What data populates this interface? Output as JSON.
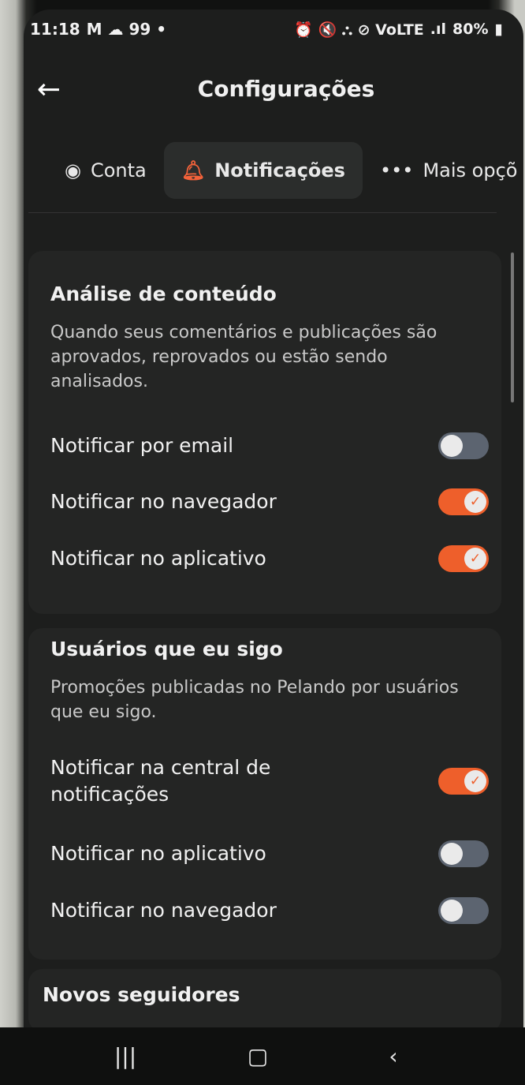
{
  "status_bar": {
    "time": "11:18",
    "left_icons": "M ☁ 99 •",
    "right_icons": "⏰ 🔇 ⛬ ⊘ VoLTE",
    "battery": "80%"
  },
  "header": {
    "title": "Configurações"
  },
  "tabs": [
    {
      "label": "Conta",
      "icon": "user-circle-icon"
    },
    {
      "label": "Notificações",
      "icon": "bell-icon"
    },
    {
      "label": "Mais opçõ",
      "icon": "more-dots-icon"
    }
  ],
  "sections": [
    {
      "title": "Análise de conteúdo",
      "description": "Quando seus comentários e publicações são aprovados, reprovados ou estão sendo analisados.",
      "rows": [
        {
          "label": "Notificar por email",
          "on": false
        },
        {
          "label": "Notificar no navegador",
          "on": true
        },
        {
          "label": "Notificar no aplicativo",
          "on": true
        }
      ]
    },
    {
      "title": "Usuários que eu sigo",
      "description": "Promoções publicadas no Pelando por usuários que eu sigo.",
      "rows": [
        {
          "label": "Notificar na central de notificações",
          "on": true
        },
        {
          "label": "Notificar no aplicativo",
          "on": false
        },
        {
          "label": "Notificar no navegador",
          "on": false
        }
      ]
    },
    {
      "title": "Novos seguidores"
    }
  ],
  "colors": {
    "accent": "#ee5f2b",
    "toggle_off": "#5c6470",
    "card": "#242524",
    "background": "#1d1e1d"
  }
}
